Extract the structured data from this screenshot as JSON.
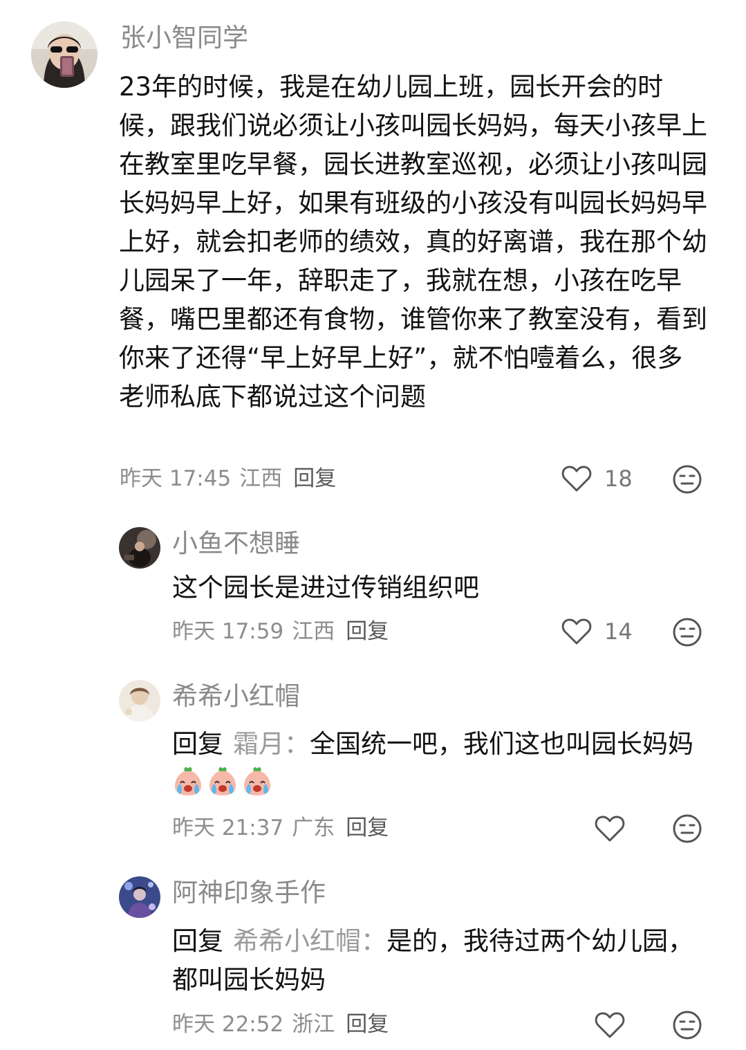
{
  "comments": [
    {
      "author": "张小智同学",
      "text": "23年的时候，我是在幼儿园上班，园长开会的时候，跟我们说必须让小孩叫园长妈妈，每天小孩早上在教室里吃早餐，园长进教室巡视，必须让小孩叫园长妈妈早上好，如果有班级的小孩没有叫园长妈妈早上好，就会扣老师的绩效，真的好离谱，我在那个幼儿园呆了一年，辞职走了，我就在想，小孩在吃早餐，嘴巴里都还有食物，谁管你来了教室没有，看到你来了还得“早上好早上好”，就不怕噎着么，很多老师私底下都说过这个问题",
      "time": "昨天 17:45",
      "location": "江西",
      "reply_label": "回复",
      "likes": "18"
    }
  ],
  "replies": [
    {
      "author": "小鱼不想睡",
      "text": "这个园长是进过传销组织吧",
      "time": "昨天 17:59",
      "location": "江西",
      "reply_label": "回复",
      "likes": "14"
    },
    {
      "author": "希希小红帽",
      "prefix": "回复",
      "target": "霜月：",
      "text": "全国统一吧，我们这也叫园长妈妈",
      "emojis": [
        "crying-peach-emoji",
        "crying-peach-emoji",
        "crying-peach-emoji"
      ],
      "time": "昨天 21:37",
      "location": "广东",
      "reply_label": "回复",
      "likes": ""
    },
    {
      "author": "阿神印象手作",
      "prefix": "回复",
      "target": "希希小红帽：",
      "text": "是的，我待过两个幼儿园，都叫园长妈妈",
      "time": "昨天 22:52",
      "location": "浙江",
      "reply_label": "回复",
      "likes": ""
    }
  ],
  "icons": {
    "like": "heart-outline-icon",
    "dislike": "neutral-face-icon"
  },
  "colors": {
    "name": "#8a8a8a",
    "meta": "#8d8d8d",
    "text": "#121212",
    "icon": "#555555"
  }
}
